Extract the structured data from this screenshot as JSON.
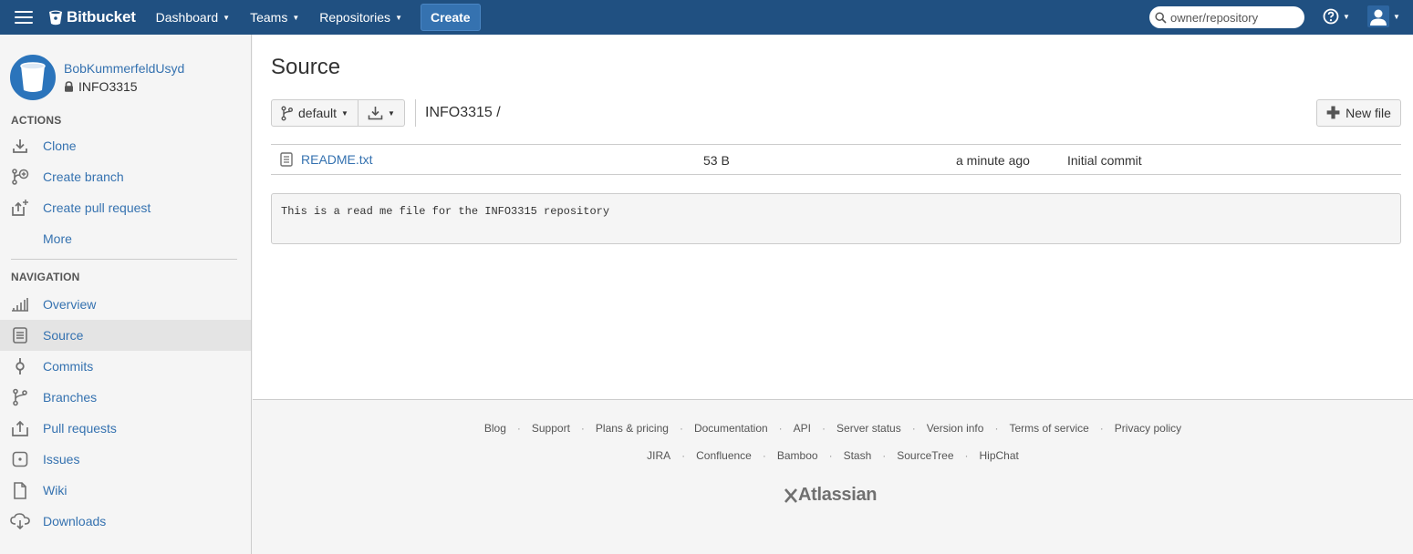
{
  "header": {
    "brand": "Bitbucket",
    "nav": [
      {
        "label": "Dashboard"
      },
      {
        "label": "Teams"
      },
      {
        "label": "Repositories"
      }
    ],
    "create_label": "Create",
    "search_placeholder": "owner/repository",
    "colors": {
      "bar": "#205081",
      "create": "#3572b0"
    }
  },
  "sidebar": {
    "owner": "BobKummerfeldUsyd",
    "repo": "INFO3315",
    "actions_title": "ACTIONS",
    "actions": [
      {
        "label": "Clone",
        "icon": "download-icon"
      },
      {
        "label": "Create branch",
        "icon": "create-branch-icon"
      },
      {
        "label": "Create pull request",
        "icon": "create-pull-request-icon"
      },
      {
        "label": "More",
        "icon": ""
      }
    ],
    "navigation_title": "NAVIGATION",
    "navigation": [
      {
        "label": "Overview",
        "icon": "overview-icon"
      },
      {
        "label": "Source",
        "icon": "source-icon",
        "active": true
      },
      {
        "label": "Commits",
        "icon": "commits-icon"
      },
      {
        "label": "Branches",
        "icon": "branches-icon"
      },
      {
        "label": "Pull requests",
        "icon": "pull-requests-icon"
      },
      {
        "label": "Issues",
        "icon": "issues-icon"
      },
      {
        "label": "Wiki",
        "icon": "wiki-icon"
      },
      {
        "label": "Downloads",
        "icon": "downloads-icon"
      }
    ]
  },
  "main": {
    "title": "Source",
    "branch": "default",
    "breadcrumb": "INFO3315 /",
    "new_file_label": "New file",
    "files": [
      {
        "name": "README.txt",
        "size": "53 B",
        "age": "a minute ago",
        "message": "Initial commit"
      }
    ],
    "readme_text": "This is a read me file for the INFO3315 repository"
  },
  "footer": {
    "row1": [
      "Blog",
      "Support",
      "Plans & pricing",
      "Documentation",
      "API",
      "Server status",
      "Version info",
      "Terms of service",
      "Privacy policy"
    ],
    "row2": [
      "JIRA",
      "Confluence",
      "Bamboo",
      "Stash",
      "SourceTree",
      "HipChat"
    ],
    "brand": "Atlassian"
  }
}
